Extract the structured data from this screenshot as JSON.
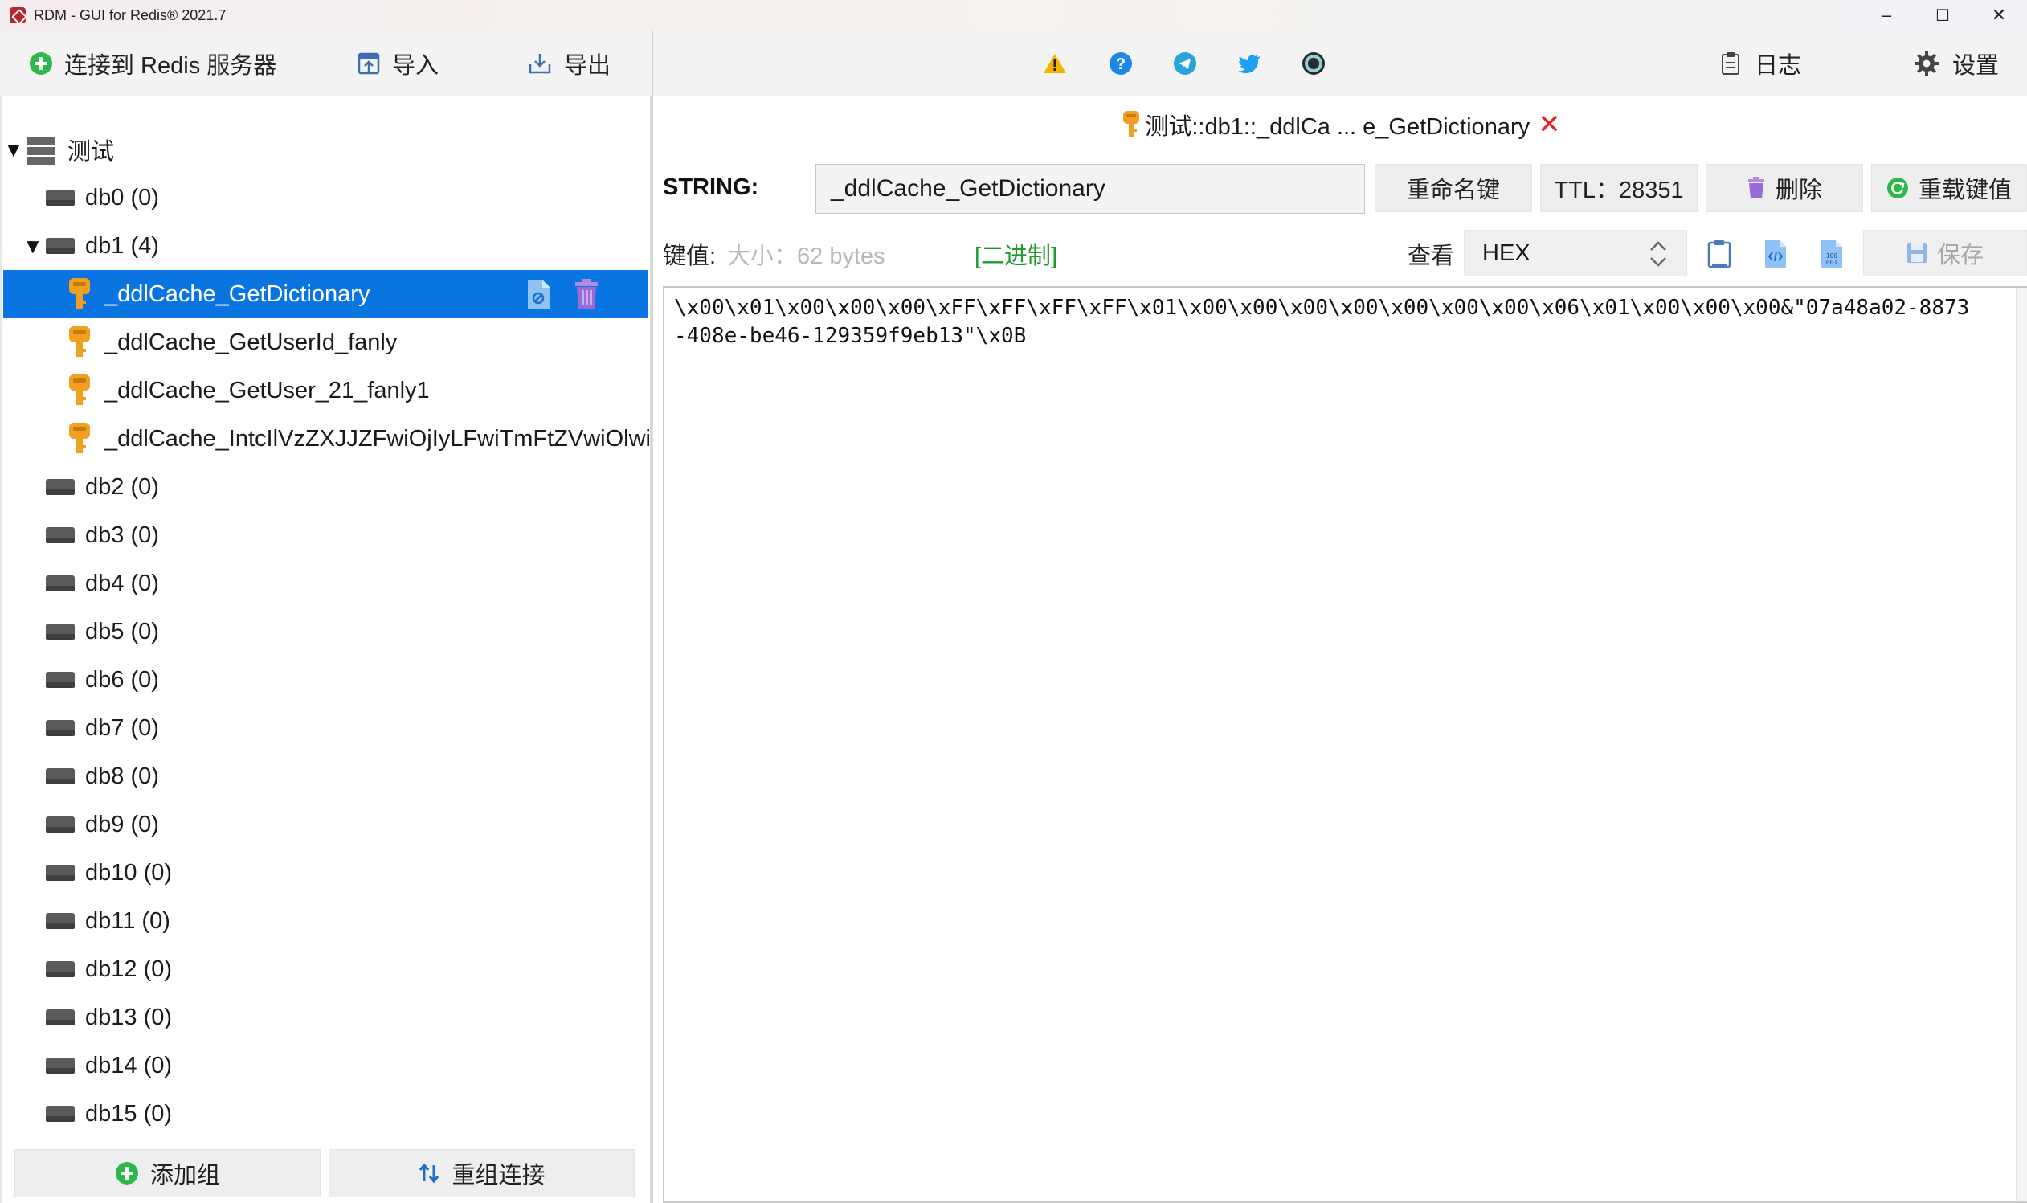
{
  "window": {
    "title": "RDM - GUI for Redis® 2021.7",
    "minimize": "–",
    "maximize": "☐",
    "close": "✕"
  },
  "toolbar": {
    "connect": "连接到 Redis 服务器",
    "import": "导入",
    "export": "导出",
    "log": "日志",
    "settings": "设置",
    "center_icons": [
      "warning-icon",
      "help-icon",
      "telegram-icon",
      "twitter-icon",
      "github-icon"
    ]
  },
  "tree": {
    "connection": "测试",
    "rows": [
      {
        "kind": "db",
        "label": "db0  (0)"
      },
      {
        "kind": "db",
        "label": "db1  (4)",
        "expanded": true
      },
      {
        "kind": "key",
        "label": "_ddlCache_GetDictionary",
        "selected": true
      },
      {
        "kind": "key",
        "label": "_ddlCache_GetUserId_fanly"
      },
      {
        "kind": "key",
        "label": "_ddlCache_GetUser_21_fanly1"
      },
      {
        "kind": "key",
        "label": "_ddlCache_IntcIlVzZXJJZFwiOjIyLFwiTmFtZVwiOlwiY"
      },
      {
        "kind": "db",
        "label": "db2  (0)"
      },
      {
        "kind": "db",
        "label": "db3  (0)"
      },
      {
        "kind": "db",
        "label": "db4  (0)"
      },
      {
        "kind": "db",
        "label": "db5  (0)"
      },
      {
        "kind": "db",
        "label": "db6  (0)"
      },
      {
        "kind": "db",
        "label": "db7  (0)"
      },
      {
        "kind": "db",
        "label": "db8  (0)"
      },
      {
        "kind": "db",
        "label": "db9  (0)"
      },
      {
        "kind": "db",
        "label": "db10  (0)"
      },
      {
        "kind": "db",
        "label": "db11  (0)"
      },
      {
        "kind": "db",
        "label": "db12  (0)"
      },
      {
        "kind": "db",
        "label": "db13  (0)"
      },
      {
        "kind": "db",
        "label": "db14  (0)"
      },
      {
        "kind": "db",
        "label": "db15  (0)"
      }
    ],
    "add_group": "添加组",
    "regroup": "重组连接"
  },
  "editor": {
    "tab_title": "测试::db1::_ddlCa ... e_GetDictionary",
    "tab_close": "✕",
    "type": "STRING:",
    "key_name": "_ddlCache_GetDictionary",
    "rename": "重命名键",
    "ttl": "TTL：28351",
    "delete": "删除",
    "reload": "重载键值",
    "value_label": "键值:",
    "size": "大小：62 bytes",
    "binary": "[二进制]",
    "view_label": "查看",
    "view_mode": "HEX",
    "save": "保存",
    "value_line1": "\\x00\\x01\\x00\\x00\\x00\\xFF\\xFF\\xFF\\xFF\\x01\\x00\\x00\\x00\\x00\\x00\\x00\\x00\\x06\\x01\\x00\\x00\\x00&\"07a48a02-8873",
    "value_line2": "-408e-be46-129359f9eb13\"\\x0B"
  },
  "colors": {
    "selection": "#0a74e0",
    "key_icon": "#f0a020",
    "binary_text": "#1c9a2c",
    "close_x": "#e32424"
  }
}
